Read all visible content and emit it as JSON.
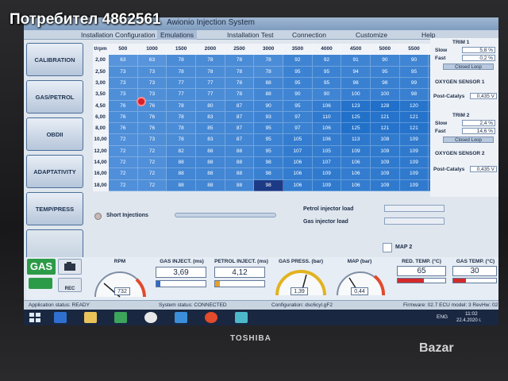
{
  "overlay": {
    "watermark": "Потребител 4862561",
    "marketplace": "Bazar"
  },
  "laptop": {
    "brand": "TOSHIBA"
  },
  "window": {
    "title": "Awionio Injection System"
  },
  "menu": [
    "Installation Configuration",
    "Emulations",
    "Installation Test",
    "Connection",
    "Customize",
    "Help"
  ],
  "nav": [
    "CALIBRATION",
    "GAS/PETROL",
    "OBDII",
    "ADAPTATIVITY",
    "TEMP/PRESS",
    ""
  ],
  "map": {
    "corner": "t/rpm",
    "columns": [
      "500",
      "1000",
      "1500",
      "2000",
      "2500",
      "3000",
      "3500",
      "4000",
      "4500",
      "5000",
      "5500",
      "6000"
    ],
    "rows": [
      {
        "label": "2,00",
        "values": [
          "63",
          "63",
          "78",
          "78",
          "78",
          "78",
          "92",
          "92",
          "91",
          "90",
          "90",
          "90"
        ]
      },
      {
        "label": "2,50",
        "values": [
          "73",
          "73",
          "78",
          "78",
          "78",
          "78",
          "95",
          "95",
          "94",
          "95",
          "95",
          "95"
        ]
      },
      {
        "label": "3,00",
        "values": [
          "73",
          "73",
          "77",
          "77",
          "78",
          "88",
          "95",
          "95",
          "98",
          "98",
          "99",
          "99"
        ]
      },
      {
        "label": "3,50",
        "values": [
          "73",
          "73",
          "77",
          "77",
          "78",
          "88",
          "90",
          "90",
          "100",
          "100",
          "98",
          "99"
        ]
      },
      {
        "label": "4,50",
        "values": [
          "76",
          "76",
          "78",
          "80",
          "87",
          "90",
          "95",
          "106",
          "123",
          "128",
          "120",
          "115"
        ]
      },
      {
        "label": "6,00",
        "values": [
          "76",
          "76",
          "78",
          "83",
          "87",
          "93",
          "97",
          "110",
          "125",
          "121",
          "121",
          "121"
        ]
      },
      {
        "label": "8,00",
        "values": [
          "76",
          "76",
          "78",
          "85",
          "87",
          "95",
          "97",
          "106",
          "125",
          "121",
          "121",
          "121"
        ]
      },
      {
        "label": "10,00",
        "values": [
          "72",
          "73",
          "78",
          "83",
          "87",
          "95",
          "105",
          "106",
          "113",
          "108",
          "109",
          "117"
        ]
      },
      {
        "label": "12,00",
        "values": [
          "72",
          "72",
          "82",
          "88",
          "88",
          "95",
          "107",
          "105",
          "109",
          "109",
          "109",
          "117"
        ]
      },
      {
        "label": "14,00",
        "values": [
          "72",
          "72",
          "88",
          "88",
          "88",
          "98",
          "106",
          "107",
          "106",
          "109",
          "109",
          "117"
        ]
      },
      {
        "label": "16,00",
        "values": [
          "72",
          "72",
          "88",
          "88",
          "88",
          "98",
          "106",
          "109",
          "106",
          "109",
          "109",
          "117"
        ]
      },
      {
        "label": "18,00",
        "values": [
          "72",
          "72",
          "88",
          "88",
          "88",
          "98",
          "106",
          "109",
          "106",
          "109",
          "109",
          "117"
        ]
      }
    ],
    "selected_cell": "98"
  },
  "right_panel": {
    "trim1_title": "TRIM 1",
    "slow_label": "Slow",
    "slow_value": "5,8 %",
    "fast_label": "Fast",
    "fast_value": "0,2 %",
    "loop1": "Closed Loop",
    "oxygen1_title": "OXYGEN SENSOR 1",
    "post_cat_label": "Post-Catalys",
    "post_cat_value": "0,435 V",
    "trim2_title": "TRIM 2",
    "slow2_label": "Slow",
    "slow2_value": "2,4 %",
    "fast2_label": "Fast",
    "fast2_value": "14,6 %",
    "loop2": "Closed Loop",
    "oxygen2_title": "OXYGEN SENSOR 2",
    "post_cat2_label": "Post-Catalys",
    "post_cat2_value": "0,435 V"
  },
  "middle": {
    "short_injections": "Short Injections",
    "petrol_injector_load": "Petrol injector load",
    "gas_injector_load": "Gas injector load",
    "map2": "MAP 2"
  },
  "gauges": {
    "gas_label": "GAS",
    "rec_label": "REC",
    "rpm_label": "RPM",
    "rpm_value": "732",
    "gas_inject_label": "GAS INJECT. (ms)",
    "gas_inject_value": "3,69",
    "gas_inject_level": 0.08,
    "petrol_inject_label": "PETROL INJECT. (ms)",
    "petrol_inject_value": "4,12",
    "petrol_inject_level": 0.1,
    "gas_press_label": "GAS PRESS. (bar)",
    "gas_press_value": "1,39",
    "map_label": "MAP (bar)",
    "map_value": "0,44",
    "red_temp_label": "RED. TEMP. (°C)",
    "red_temp_value": "65",
    "gas_temp_label": "GAS TEMP. (°C)",
    "gas_temp_value": "30"
  },
  "status": {
    "app": "Application status: READY",
    "system": "System status: CONNECTED",
    "configuration": "Configuration: dsc6cyl.gF2",
    "firmware": "Firmware: 02.7 ECU model: 3 RevHw: 02"
  },
  "taskbar": {
    "time": "11:02",
    "date": "22.4.2020 г.",
    "lang": "ENG"
  },
  "colors": {
    "map_cell": "#3d76c2",
    "selected": "#1d3a86",
    "red_bar": "#d42a2a"
  }
}
